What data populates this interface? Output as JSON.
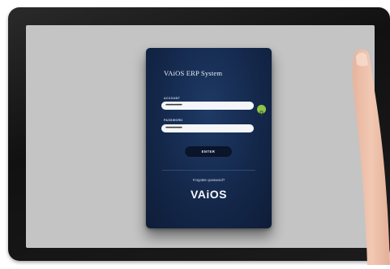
{
  "login": {
    "title": "VAiOS ERP System",
    "account_label": "ACCOUNT",
    "account_value": "••••••••••••••••••",
    "password_label": "PASSWORD",
    "password_value": "••••••••••••••••••",
    "enter_label": "ENTER",
    "forgot_label": "Forgotten password?",
    "logo_text": "VAiOS"
  },
  "icons": {
    "key_button": "key-icon"
  },
  "colors": {
    "card_background": "#14284b",
    "key_button": "#8fc34a",
    "screen_background": "#c4c4c4"
  }
}
